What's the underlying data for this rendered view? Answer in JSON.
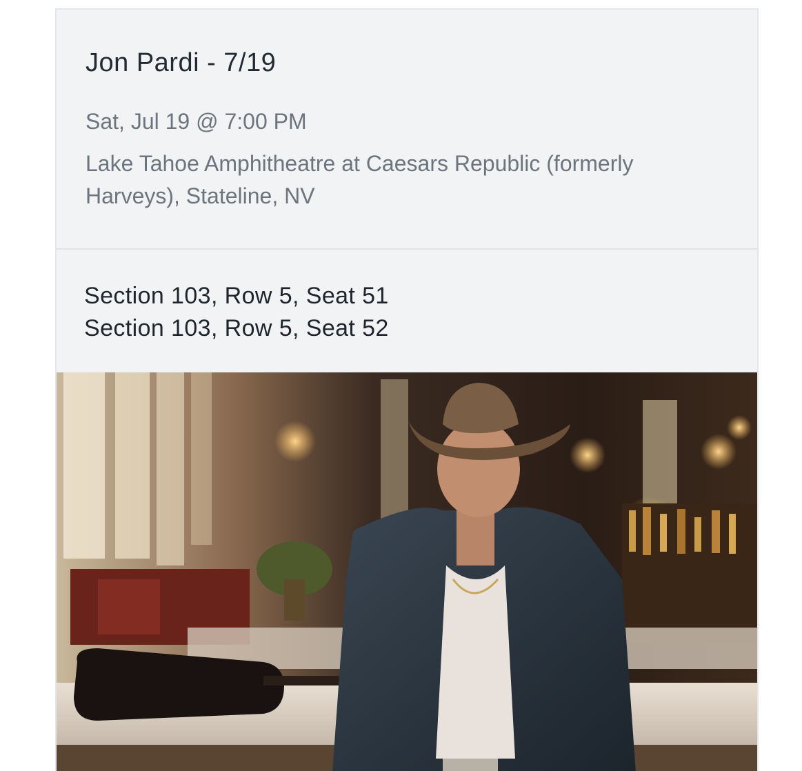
{
  "event": {
    "title": "Jon Pardi - 7/19",
    "datetime": "Sat, Jul 19 @ 7:00 PM",
    "venue": "Lake Tahoe Amphitheatre at Caesars Republic (formerly Harveys), Stateline, NV"
  },
  "seats": [
    "Section 103, Row 5, Seat 51",
    "Section 103, Row 5, Seat 52"
  ],
  "photo": {
    "subject": "artist-photo",
    "colors": {
      "background_dark": "#2a1d16",
      "window_light": "#d8c7ab",
      "hat": "#7a5f46",
      "denim": "#27323d",
      "skin": "#b98568",
      "warm_light": "#f0b45b"
    }
  }
}
